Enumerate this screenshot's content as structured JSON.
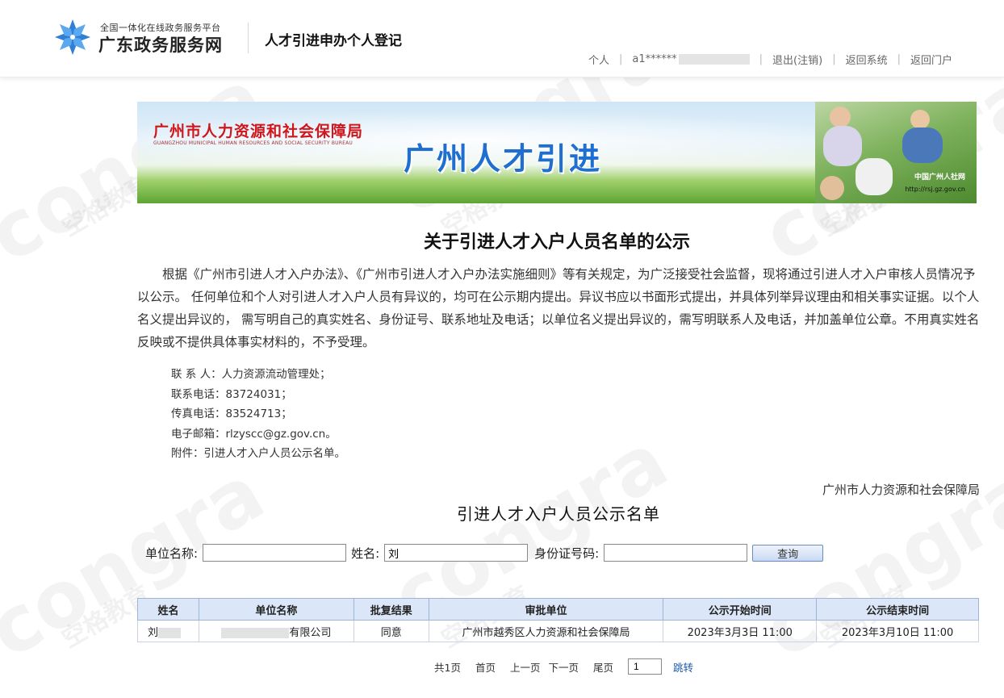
{
  "header": {
    "platform_subtitle": "全国一体化在线政务服务平台",
    "platform_name": "广东政务服务网",
    "page_title": "人才引进申办个人登记",
    "nav": {
      "personal": "个人",
      "user_prefix": "a1******",
      "logout": "退出(注销)",
      "back_system": "返回系统",
      "back_portal": "返回门户"
    }
  },
  "banner": {
    "org_cn": "广州市人力资源和社会保障局",
    "org_en": "GUANGZHOU MUNICIPAL HUMAN RESOURCES AND SOCIAL SECURITY BUREAU",
    "headline": "广州人才引进",
    "brand": "中国广州人社网",
    "url": "http://rsj.gz.gov.cn"
  },
  "notice": {
    "title": "关于引进人才入户人员名单的公示",
    "body": "根据《广州市引进人才入户办法》、《广州市引进人才入户办法实施细则》等有关规定，为广泛接受社会监督，现将通过引进人才入户审核人员情况予以公示。 任何单位和个人对引进人才入户人员有异议的，均可在公示期内提出。异议书应以书面形式提出，并具体列举异议理由和相关事实证据。以个人名义提出异议的， 需写明自己的真实姓名、身份证号、联系地址及电话；以单位名义提出异议的，需写明联系人及电话，并加盖单位公章。不用真实姓名反映或不提供具体事实材料的，不予受理。",
    "contact_person": "联 系 人：人力资源流动管理处；",
    "phone": "联系电话：83724031；",
    "fax": "传真电话：83524713；",
    "email": "电子邮箱：rlzyscc@gz.gov.cn。",
    "attachment": "附件：引进人才入户人员公示名单。",
    "signer": "广州市人力资源和社会保障局"
  },
  "list_title": "引进人才入户人员公示名单",
  "search": {
    "unit_label": "单位名称:",
    "unit_value": "",
    "name_label": "姓名:",
    "name_value": "刘",
    "id_label": "身份证号码:",
    "id_value": "",
    "query_button": "查询"
  },
  "table": {
    "headers": [
      "姓名",
      "单位名称",
      "批复结果",
      "审批单位",
      "公示开始时间",
      "公示结束时间"
    ],
    "rows": [
      {
        "name": "刘",
        "unit_suffix": "有限公司",
        "result": "同意",
        "approver": "广州市越秀区人力资源和社会保障局",
        "start": "2023年3月3日 11:00",
        "end": "2023年3月10日 11:00"
      }
    ]
  },
  "pager": {
    "total": "共1页",
    "first": "首页",
    "prev": "上一页",
    "next": "下一页",
    "last": "尾页",
    "page_value": "1",
    "jump": "跳转"
  },
  "watermark": {
    "latin": "congra",
    "cn": "空格教育"
  },
  "colors": {
    "banner_red": "#d0161b",
    "banner_blue": "#1e6fd0",
    "table_header": "#dbe7f8"
  }
}
